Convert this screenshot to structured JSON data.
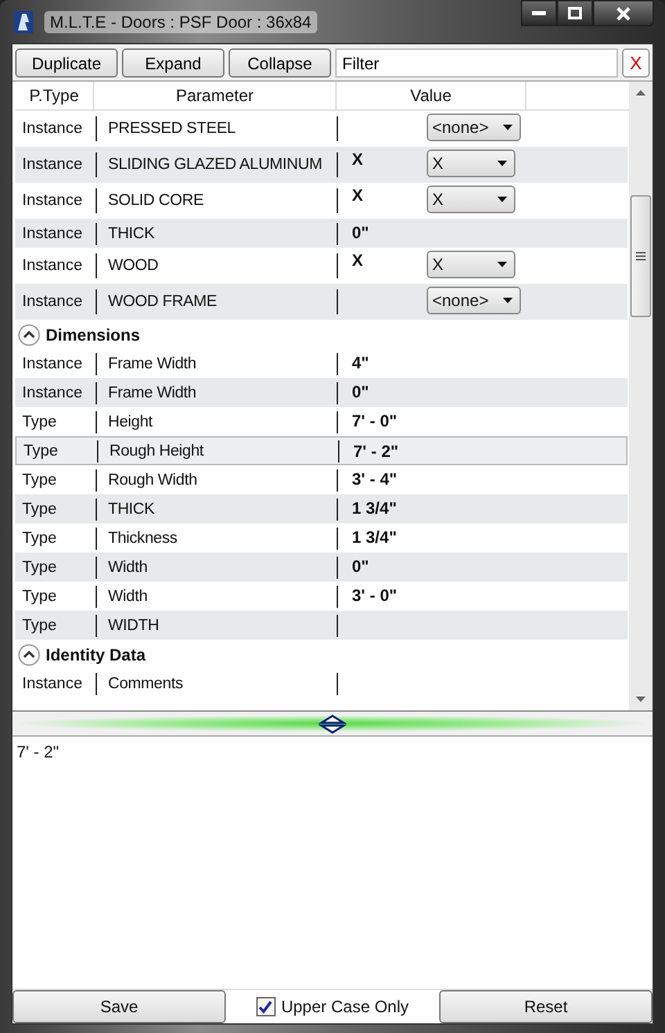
{
  "window": {
    "title": "M.L.T.E - Doors : PSF Door : 36x84"
  },
  "toolbar": {
    "buttons": [
      "Duplicate",
      "Expand",
      "Collapse"
    ],
    "filter": {
      "value": "Filter"
    },
    "clear": "X"
  },
  "grid": {
    "columns": [
      "P.Type",
      "Parameter",
      "Value"
    ],
    "groups": [
      {
        "rows": [
          {
            "ptype": "Instance",
            "parameter": "PRESSED STEEL",
            "value": null,
            "dropdown": "<none>",
            "selected": false
          },
          {
            "ptype": "Instance",
            "parameter": "SLIDING GLAZED ALUMINUM",
            "value": "X",
            "dropdown": "X",
            "selected": false
          },
          {
            "ptype": "Instance",
            "parameter": "SOLID CORE",
            "value": "X",
            "dropdown": "X",
            "selected": false
          },
          {
            "ptype": "Instance",
            "parameter": "THICK",
            "value": "0\"",
            "dropdown": null,
            "selected": false
          },
          {
            "ptype": "Instance",
            "parameter": "WOOD",
            "value": "X",
            "dropdown": "X",
            "selected": false
          },
          {
            "ptype": "Instance",
            "parameter": "WOOD FRAME",
            "value": null,
            "dropdown": "<none>",
            "selected": false
          }
        ]
      },
      {
        "name": "Dimensions",
        "expanded": true,
        "rows": [
          {
            "ptype": "Instance",
            "parameter": "Frame Width",
            "value": "4\"",
            "dropdown": null,
            "selected": false
          },
          {
            "ptype": "Instance",
            "parameter": "Frame Width",
            "value": "0\"",
            "dropdown": null,
            "selected": false
          },
          {
            "ptype": "Type",
            "parameter": "Height",
            "value": "7' - 0\"",
            "dropdown": null,
            "selected": false
          },
          {
            "ptype": "Type",
            "parameter": "Rough Height",
            "value": "7' - 2\"",
            "dropdown": null,
            "selected": true
          },
          {
            "ptype": "Type",
            "parameter": "Rough Width",
            "value": "3' - 4\"",
            "dropdown": null,
            "selected": false
          },
          {
            "ptype": "Type",
            "parameter": "THICK",
            "value": "1 3/4\"",
            "dropdown": null,
            "selected": false
          },
          {
            "ptype": "Type",
            "parameter": "Thickness",
            "value": "1 3/4\"",
            "dropdown": null,
            "selected": false
          },
          {
            "ptype": "Type",
            "parameter": "Width",
            "value": "0\"",
            "dropdown": null,
            "selected": false
          },
          {
            "ptype": "Type",
            "parameter": "Width",
            "value": "3' - 0\"",
            "dropdown": null,
            "selected": false
          },
          {
            "ptype": "Type",
            "parameter": "WIDTH",
            "value": null,
            "dropdown": null,
            "selected": false
          }
        ]
      },
      {
        "name": "Identity Data",
        "expanded": true,
        "rows": [
          {
            "ptype": "Instance",
            "parameter": "Comments",
            "value": null,
            "dropdown": null,
            "selected": false
          }
        ]
      }
    ]
  },
  "editor": {
    "value": "7' - 2\""
  },
  "footer": {
    "save": "Save",
    "upper_case": {
      "label": "Upper Case Only",
      "checked": true
    },
    "reset": "Reset"
  }
}
